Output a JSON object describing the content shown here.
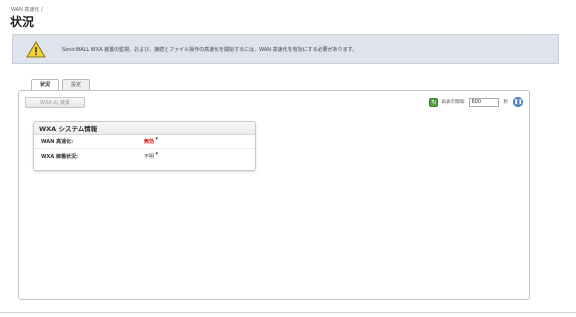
{
  "breadcrumb": "WAN 高速化 /",
  "page_title": "状況",
  "banner": {
    "text": "SonicWALL WXA 装置の監視、および、接続とファイル操作の高速化を開始するには、WAN 高速化を有効にする必要があります。",
    "icon": "warning-icon"
  },
  "tabs": [
    {
      "label": "状況",
      "active": true
    },
    {
      "label": "設定",
      "active": false
    }
  ],
  "toolbar": {
    "wxa_button_label": "WXA の 装置",
    "refresh_label": "再表示間隔:",
    "refresh_value": "600",
    "refresh_unit": "秒"
  },
  "info": {
    "title": "WXA システム情報",
    "rows": [
      {
        "label": "WAN 高速化:",
        "value": "無効"
      },
      {
        "label": "WXA 稼働状況:",
        "value": "不明"
      }
    ]
  },
  "colors": {
    "disabled_value": "#d81d1d",
    "banner_bg": "#dfe3ec"
  }
}
